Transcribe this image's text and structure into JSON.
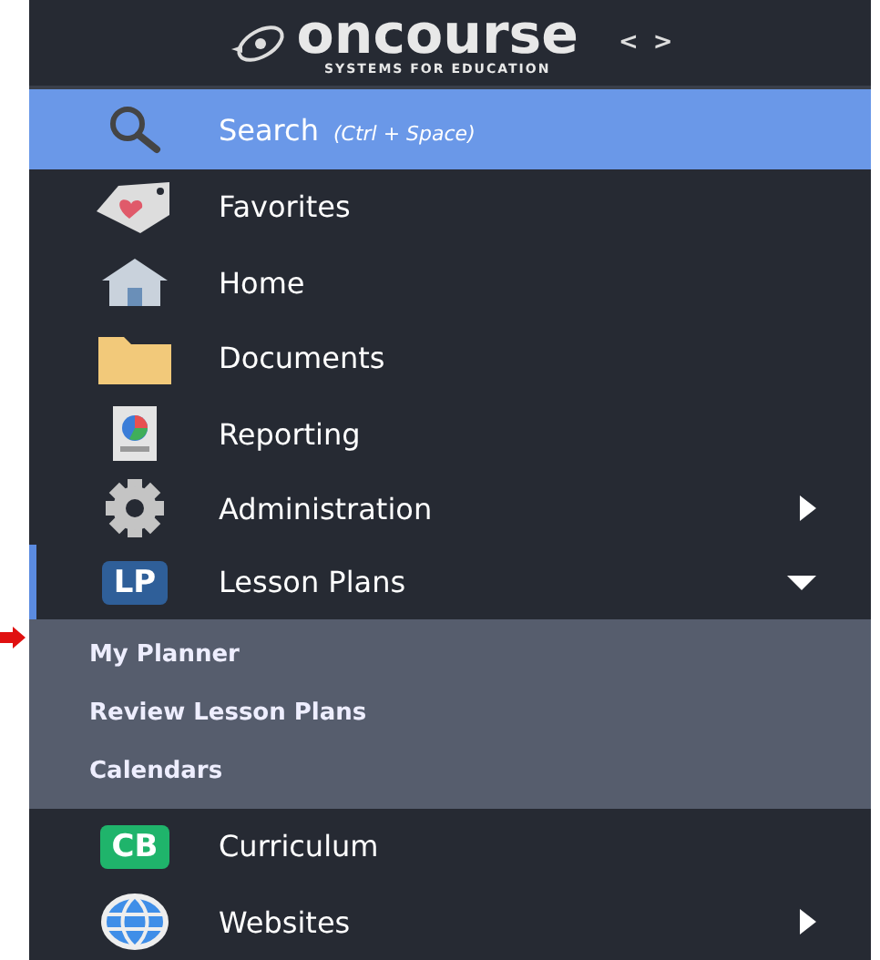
{
  "logo": {
    "name": "oncourse",
    "tagline": "SYSTEMS FOR EDUCATION"
  },
  "nav_arrows": {
    "left": "<",
    "right": ">"
  },
  "menu": [
    {
      "label": "Search",
      "hint": "(Ctrl + Space)",
      "selected": true,
      "current": false
    },
    {
      "label": "Favorites",
      "selected": false,
      "current": false
    },
    {
      "label": "Home",
      "selected": false,
      "current": false
    },
    {
      "label": "Documents",
      "selected": false,
      "current": false
    },
    {
      "label": "Reporting",
      "selected": false,
      "current": false
    },
    {
      "label": "Administration",
      "selected": false,
      "current": false,
      "expanded": false
    },
    {
      "label": "Lesson Plans",
      "badge": "LP",
      "color": "#2f5f99",
      "selected": false,
      "current": true,
      "expanded": true,
      "children": [
        {
          "label": "My Planner"
        },
        {
          "label": "Review Lesson Plans"
        },
        {
          "label": "Calendars"
        }
      ]
    },
    {
      "label": "Curriculum",
      "badge": "CB",
      "color": "#1fb46b",
      "selected": false,
      "current": false
    },
    {
      "label": "Websites",
      "selected": false,
      "current": false,
      "expanded": false
    }
  ]
}
